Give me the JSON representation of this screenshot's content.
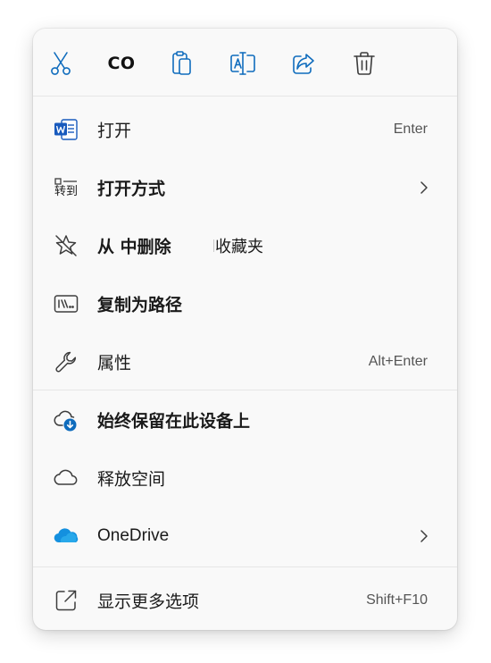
{
  "toolbar": {
    "cut_icon": "scissors-icon",
    "copy_text": "CO",
    "paste_icon": "clipboard-icon",
    "rename_icon": "rename-icon",
    "share_icon": "share-icon",
    "delete_icon": "trash-icon"
  },
  "menu": {
    "open": {
      "label": "打开",
      "accel": "Enter",
      "icon": "word-document-icon"
    },
    "open_with": {
      "label": "打开方式",
      "icon": "open-with-icon",
      "icon_text": "转到"
    },
    "remove_favorite": {
      "label": "从 中删除",
      "extra": "收藏夹",
      "icon": "unpin-star-icon"
    },
    "copy_as_path": {
      "label": "复制为路径",
      "icon": "path-icon"
    },
    "properties": {
      "label": "属性",
      "accel": "Alt+Enter",
      "icon": "wrench-icon"
    },
    "keep_on_device": {
      "label": "始终保留在此设备上",
      "icon": "cloud-download-icon"
    },
    "free_up_space": {
      "label": "释放空间",
      "icon": "cloud-icon"
    },
    "onedrive": {
      "label": "OneDrive",
      "icon": "onedrive-icon"
    },
    "show_more": {
      "label": "显示更多选项",
      "accel": "Shift+F10",
      "icon": "open-external-icon"
    }
  },
  "colors": {
    "background": "#f9f9f9",
    "accent_blue": "#0f6cbd",
    "word_blue": "#185abd",
    "onedrive_blue": "#1490df",
    "icon_gray": "#3d3d3d",
    "separator": "#e6e6e6"
  }
}
